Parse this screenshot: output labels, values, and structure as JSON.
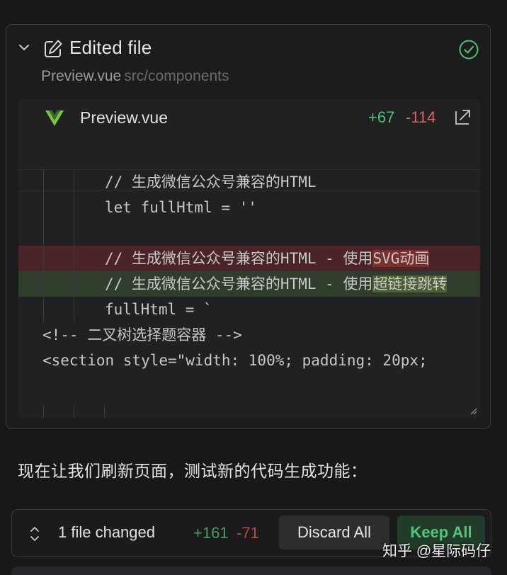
{
  "edit_card": {
    "title": "Edited file",
    "file_name": "Preview.vue",
    "file_path": "src/components",
    "inner": {
      "file_name": "Preview.vue",
      "additions": "+67",
      "deletions": "-114"
    },
    "code_lines": [
      {
        "text": "// 生成微信公众号兼容的HTML",
        "type": "normal",
        "indent": 2
      },
      {
        "text": "let fullHtml = ''",
        "type": "normal",
        "indent": 2
      },
      {
        "text": "",
        "type": "normal",
        "indent": 2
      },
      {
        "prefix": "// 生成微信公众号兼容的HTML - 使用",
        "highlight": "SVG动画",
        "type": "deleted",
        "indent": 2
      },
      {
        "prefix": "// 生成微信公众号兼容的HTML - 使用",
        "highlight": "超链接跳转",
        "type": "added",
        "indent": 2
      },
      {
        "text": "fullHtml = `",
        "type": "normal",
        "indent": 2
      },
      {
        "text": "<!-- 二叉树选择题容器 -->",
        "type": "normal",
        "indent": 0
      },
      {
        "text": "<section style=\"width: 100%; padding: 20px;",
        "type": "normal",
        "indent": 0
      }
    ]
  },
  "message": "现在让我们刷新页面，测试新的代码生成功能：",
  "bottom_bar": {
    "changed_label": "1 file changed",
    "additions": "+161",
    "deletions": "-71",
    "discard_label": "Discard All",
    "keep_label": "Keep All"
  },
  "watermark": "知乎 @星际码仔",
  "colors": {
    "background": "#18181a",
    "added": "#4fbf72",
    "deleted": "#e0625b",
    "keep_button_bg": "#213c2a"
  },
  "icons": [
    "chevron-down-icon",
    "edit-icon",
    "check-circle-icon",
    "vue-icon",
    "open-external-icon",
    "resize-handle-icon",
    "up-down-icon"
  ]
}
